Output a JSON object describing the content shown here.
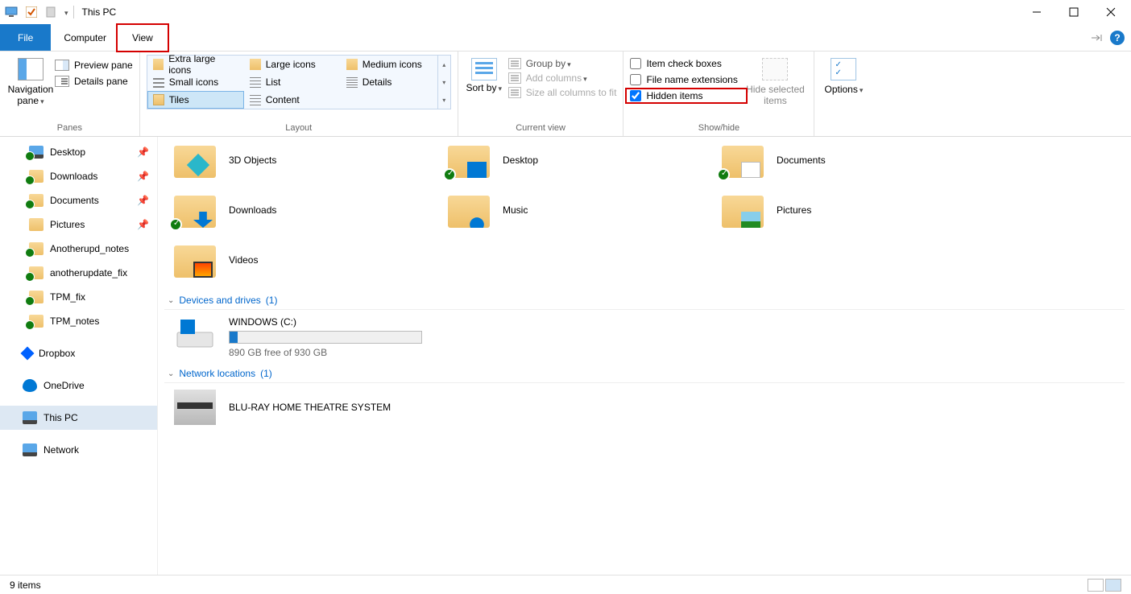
{
  "window": {
    "title": "This PC"
  },
  "tabs": {
    "file": "File",
    "computer": "Computer",
    "view": "View"
  },
  "ribbon": {
    "panes": {
      "navigation": "Navigation pane",
      "preview": "Preview pane",
      "details": "Details pane",
      "group_label": "Panes"
    },
    "layout": {
      "extra_large": "Extra large icons",
      "large": "Large icons",
      "medium": "Medium icons",
      "small": "Small icons",
      "list": "List",
      "details": "Details",
      "tiles": "Tiles",
      "content": "Content",
      "group_label": "Layout"
    },
    "current_view": {
      "sort_by": "Sort by",
      "group_by": "Group by",
      "add_columns": "Add columns",
      "size_all": "Size all columns to fit",
      "group_label": "Current view"
    },
    "show_hide": {
      "item_check_boxes": "Item check boxes",
      "file_name_ext": "File name extensions",
      "hidden_items": "Hidden items",
      "hide_selected": "Hide selected items",
      "options": "Options",
      "group_label": "Show/hide"
    }
  },
  "sidebar": {
    "items": [
      {
        "label": "Desktop",
        "icon": "monitor",
        "pinned": true,
        "sync": true
      },
      {
        "label": "Downloads",
        "icon": "folder",
        "pinned": true,
        "sync": true
      },
      {
        "label": "Documents",
        "icon": "folder",
        "pinned": true,
        "sync": true
      },
      {
        "label": "Pictures",
        "icon": "folder",
        "pinned": true,
        "sync": false
      },
      {
        "label": "Anotherupd_notes",
        "icon": "folder",
        "pinned": false,
        "sync": true
      },
      {
        "label": "anotherupdate_fix",
        "icon": "folder",
        "pinned": false,
        "sync": true
      },
      {
        "label": "TPM_fix",
        "icon": "folder",
        "pinned": false,
        "sync": true
      },
      {
        "label": "TPM_notes",
        "icon": "folder",
        "pinned": false,
        "sync": true
      }
    ],
    "dropbox": "Dropbox",
    "onedrive": "OneDrive",
    "this_pc": "This PC",
    "network": "Network"
  },
  "content": {
    "folders_row1": [
      {
        "label": "3D Objects",
        "overlay": "3d",
        "sync": false
      },
      {
        "label": "Desktop",
        "overlay": "blue",
        "sync": true
      },
      {
        "label": "Documents",
        "overlay": "doc",
        "sync": true
      }
    ],
    "folders_row2": [
      {
        "label": "Downloads",
        "overlay": "down",
        "sync": true
      },
      {
        "label": "Music",
        "overlay": "music",
        "sync": false
      },
      {
        "label": "Pictures",
        "overlay": "pic",
        "sync": false
      }
    ],
    "folders_row3": [
      {
        "label": "Videos",
        "overlay": "vid",
        "sync": false
      }
    ],
    "devices_header": {
      "text": "Devices and drives",
      "count": "(1)"
    },
    "drive": {
      "name": "WINDOWS (C:)",
      "free_text": "890 GB free of 930 GB"
    },
    "netloc_header": {
      "text": "Network locations",
      "count": "(1)"
    },
    "netloc": {
      "name": "BLU-RAY HOME THEATRE SYSTEM"
    }
  },
  "statusbar": {
    "items": "9 items"
  }
}
